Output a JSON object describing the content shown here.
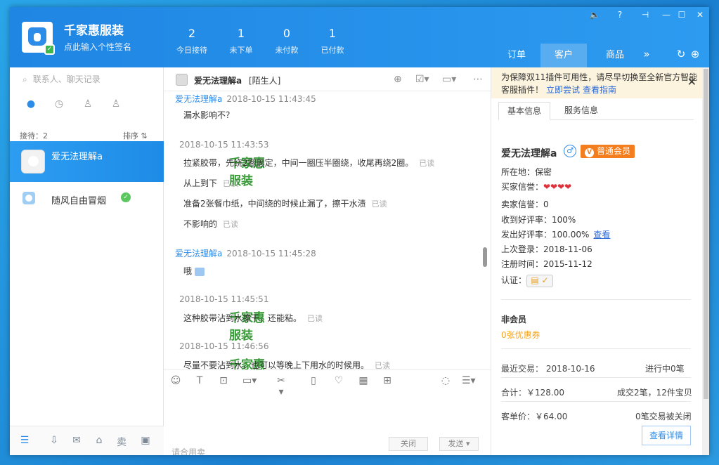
{
  "header": {
    "shop_name": "千家惠服装",
    "signature": "点此输入个性签名",
    "stats": [
      {
        "value": "2",
        "label": "今日接待"
      },
      {
        "value": "1",
        "label": "未下单"
      },
      {
        "value": "0",
        "label": "未付款"
      },
      {
        "value": "1",
        "label": "已付款"
      }
    ],
    "nav_tabs": [
      "订单",
      "客户",
      "商品"
    ],
    "active_tab": "客户"
  },
  "left": {
    "search_placeholder": "联系人、聊天记录",
    "reception_count": "接待：2",
    "sort_label": "排序",
    "contacts": [
      {
        "name": "爱无法理解a",
        "selected": true
      },
      {
        "name": "随风自由冒烟",
        "selected": false
      }
    ]
  },
  "chat": {
    "title_name": "爱无法理解a",
    "title_status": "[陌生人]",
    "messages": [
      {
        "who": "爱无法理解a",
        "time": "2018-10-15 11:43:45",
        "lines": [
          {
            "text": "漏水影响不？",
            "read": ""
          }
        ]
      },
      {
        "who": "千家惠服装",
        "time": "2018-10-15 11:43:53",
        "lines": [
          {
            "text": "拉紧胶带，先绕2圈固定，中间一圈压半圈绕，收尾再绕2圈。",
            "read": "已读"
          },
          {
            "text": "从上到下",
            "read": "已读"
          },
          {
            "text": "准备2张餐巾纸，中间绕的时候止漏了，擦干水渍",
            "read": "已读"
          },
          {
            "text": "不影响的",
            "read": "已读"
          }
        ]
      },
      {
        "who": "爱无法理解a",
        "time": "2018-10-15 11:45:28",
        "lines": [
          {
            "text": "哦",
            "read": ""
          }
        ]
      },
      {
        "who": "千家惠服装",
        "time": "2018-10-15 11:45:51",
        "lines": [
          {
            "text": "这种胶带沾到水擦干，还能粘。",
            "read": "已读"
          }
        ]
      },
      {
        "who": "千家惠服装",
        "time": "2018-10-15 11:46:56",
        "lines": [
          {
            "text": "尽量不要沾到水，也可以等晚上下用水的时候用。",
            "read": "已读"
          }
        ]
      }
    ],
    "input_placeholder": "请合用卖",
    "close_label": "关闭",
    "send_label": "发送"
  },
  "right": {
    "notice_text": "为保障双11插件可用性，请尽早切换至全新官方智能客服插件！",
    "notice_link1": "立即尝试",
    "notice_link2": "查看指南",
    "tab_basic": "基本信息",
    "tab_service": "服务信息",
    "customer_name": "爱无法理解a",
    "member_level": "普通会员",
    "location": "所在地：保密",
    "buyer_credit_label": "买家信誉：",
    "buyer_credit_hearts": "❤❤❤❤",
    "seller_credit": "卖家信誉：0",
    "good_rate_received": "收到好评率：100%",
    "good_rate_given": "发出好评率：100.00%",
    "view_link": "查看",
    "last_login": "上次登录：2018-11-06",
    "register_time": "注册时间：2015-11-12",
    "verify_label": "认证：",
    "member_status": "非会员",
    "coupons": "0张优惠券",
    "recent_trade": "最近交易：  2018-10-16",
    "in_progress": "进行中0笔",
    "total": "合计：￥128.00",
    "deals": "成交2笔，12件宝贝",
    "avg_price": "客单价：￥64.00",
    "closed": "0笔交易被关闭",
    "detail_button": "查看详情"
  }
}
